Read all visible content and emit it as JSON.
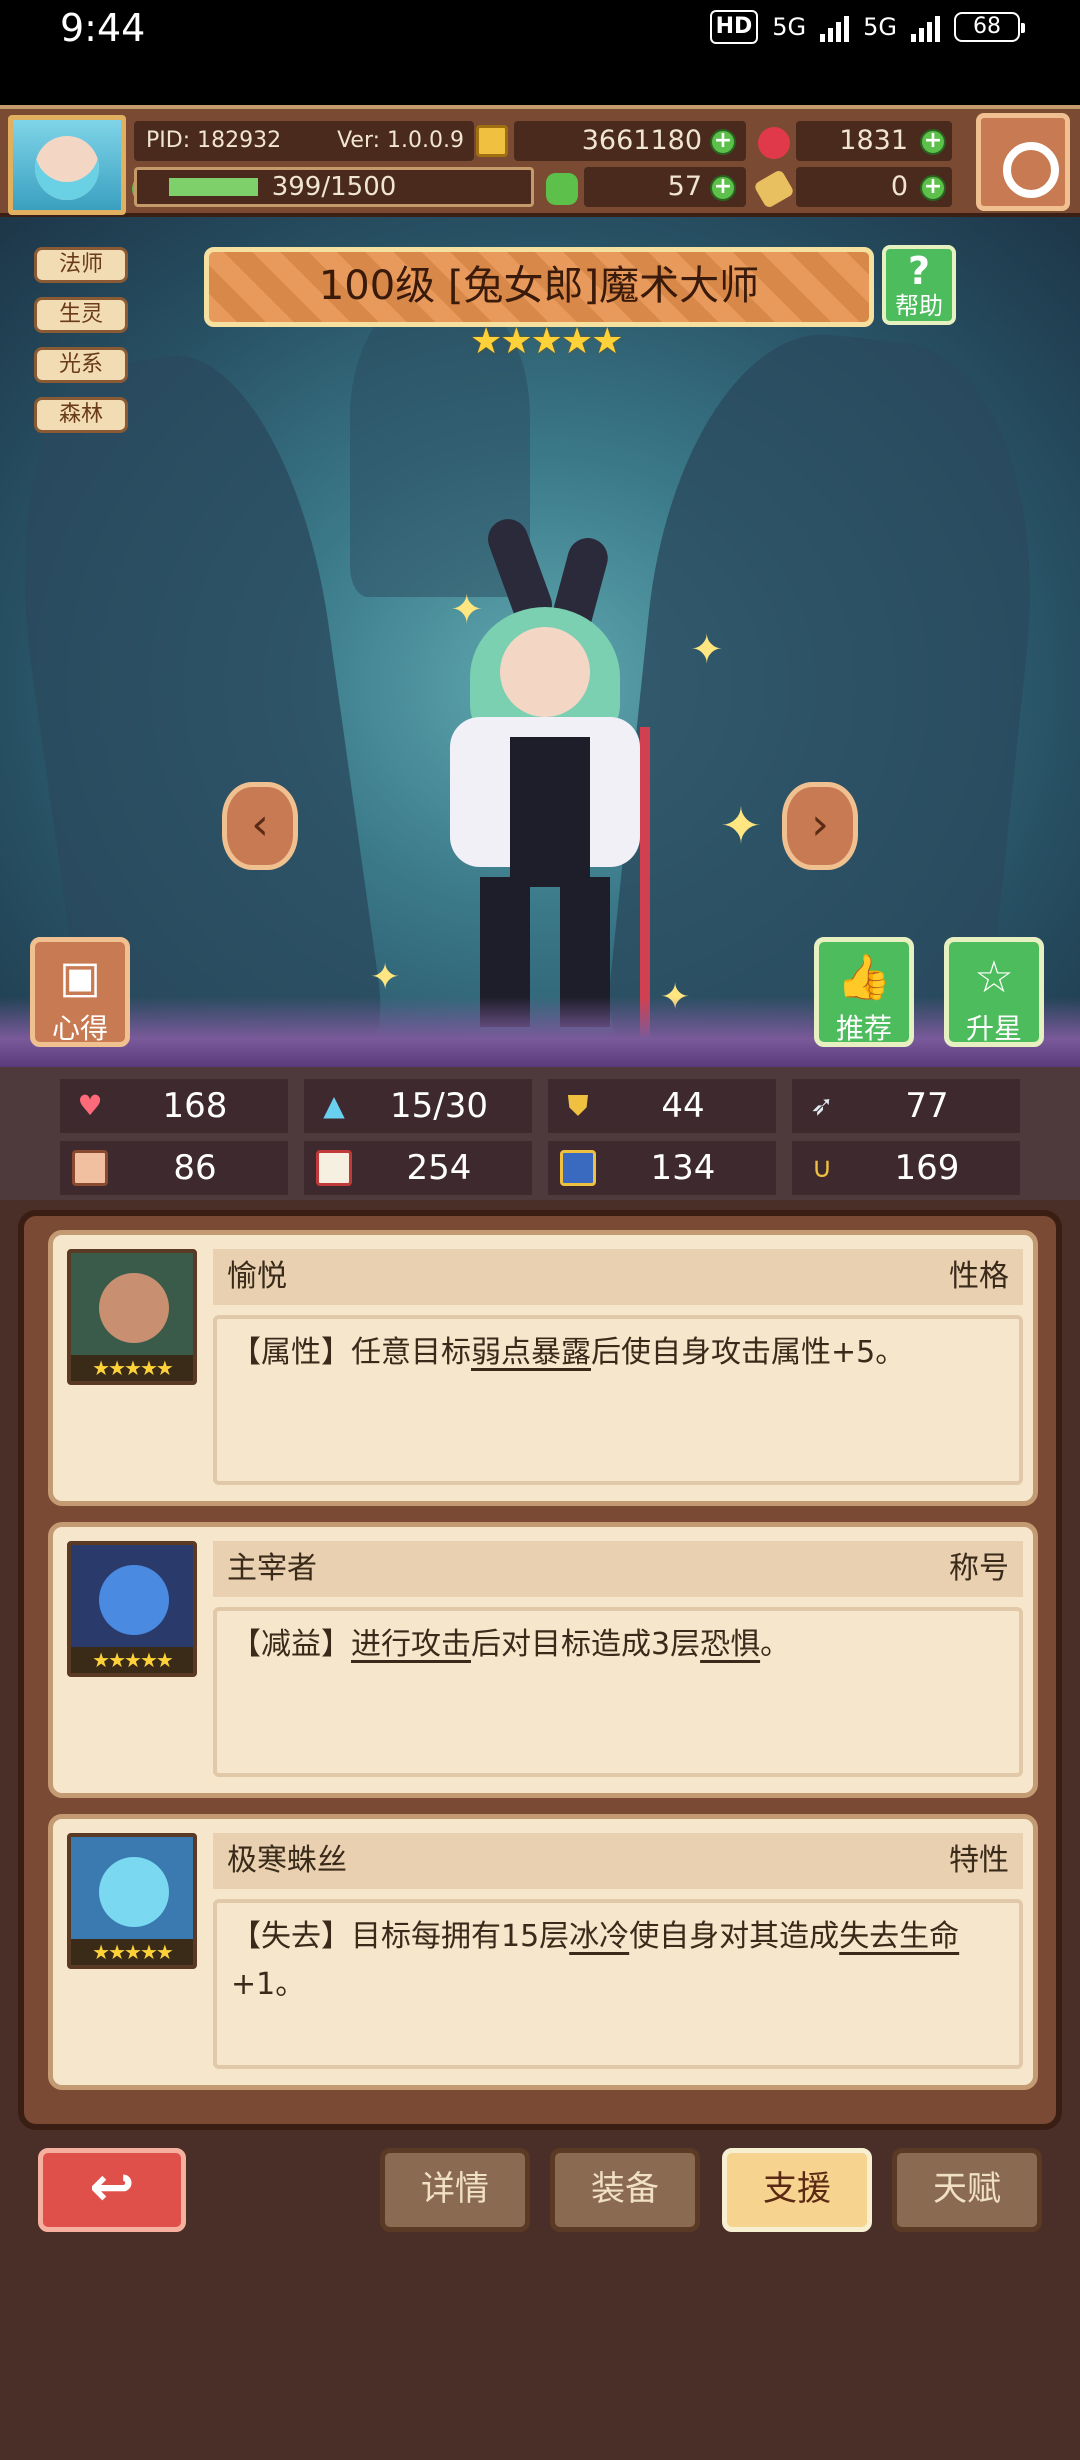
{
  "status_bar": {
    "time": "9:44",
    "hd_label": "HD",
    "net1": "5G",
    "net2": "5G",
    "battery": "68"
  },
  "top_bar": {
    "pid": "PID: 182932",
    "version": "Ver: 1.0.0.9",
    "gold": "3661180",
    "gems": "1831",
    "exp": "399/1500",
    "exp_progress": 0.266,
    "clover": "57",
    "item": "0"
  },
  "hero": {
    "tags": [
      "法师",
      "生灵",
      "光系",
      "森林"
    ],
    "title": "100级 [兔女郎]魔术大师",
    "stars": "★★★★★",
    "help_label": "帮助",
    "left_button": "心得",
    "recommend_button": "推荐",
    "upgrade_button": "升星"
  },
  "stats": {
    "hp": "168",
    "mana": "15/30",
    "defense": "44",
    "speed": "77",
    "attack": "86",
    "magic": "254",
    "resist": "134",
    "luck": "169"
  },
  "cards": [
    {
      "name": "愉悦",
      "kind": "性格",
      "stars": "★★★★★",
      "text_a": "【属性】任意目标",
      "link_a": "弱点暴露",
      "text_b": "后使自身攻击属性+5。",
      "link_b": "",
      "text_c": ""
    },
    {
      "name": "主宰者",
      "kind": "称号",
      "stars": "★★★★★",
      "text_a": "【减益】",
      "link_a": "进行攻击",
      "text_b": "后对目标造成3层",
      "link_b": "恐惧",
      "text_c": "。"
    },
    {
      "name": "极寒蛛丝",
      "kind": "特性",
      "stars": "★★★★★",
      "text_a": "【失去】目标每拥有15层",
      "link_a": "冰冷",
      "text_b": "使自身对其造成",
      "link_b": "失去生命",
      "text_c": "+1。"
    }
  ],
  "bottom": {
    "back_icon": "↩",
    "tabs": [
      "详情",
      "装备",
      "支援",
      "天赋"
    ],
    "active_tab": "支援"
  },
  "colors": {
    "panel_bg": "#4a2e28",
    "card_bg": "#f6e6cc",
    "active_tab": "#f6d490",
    "back_button": "#e0504a"
  }
}
